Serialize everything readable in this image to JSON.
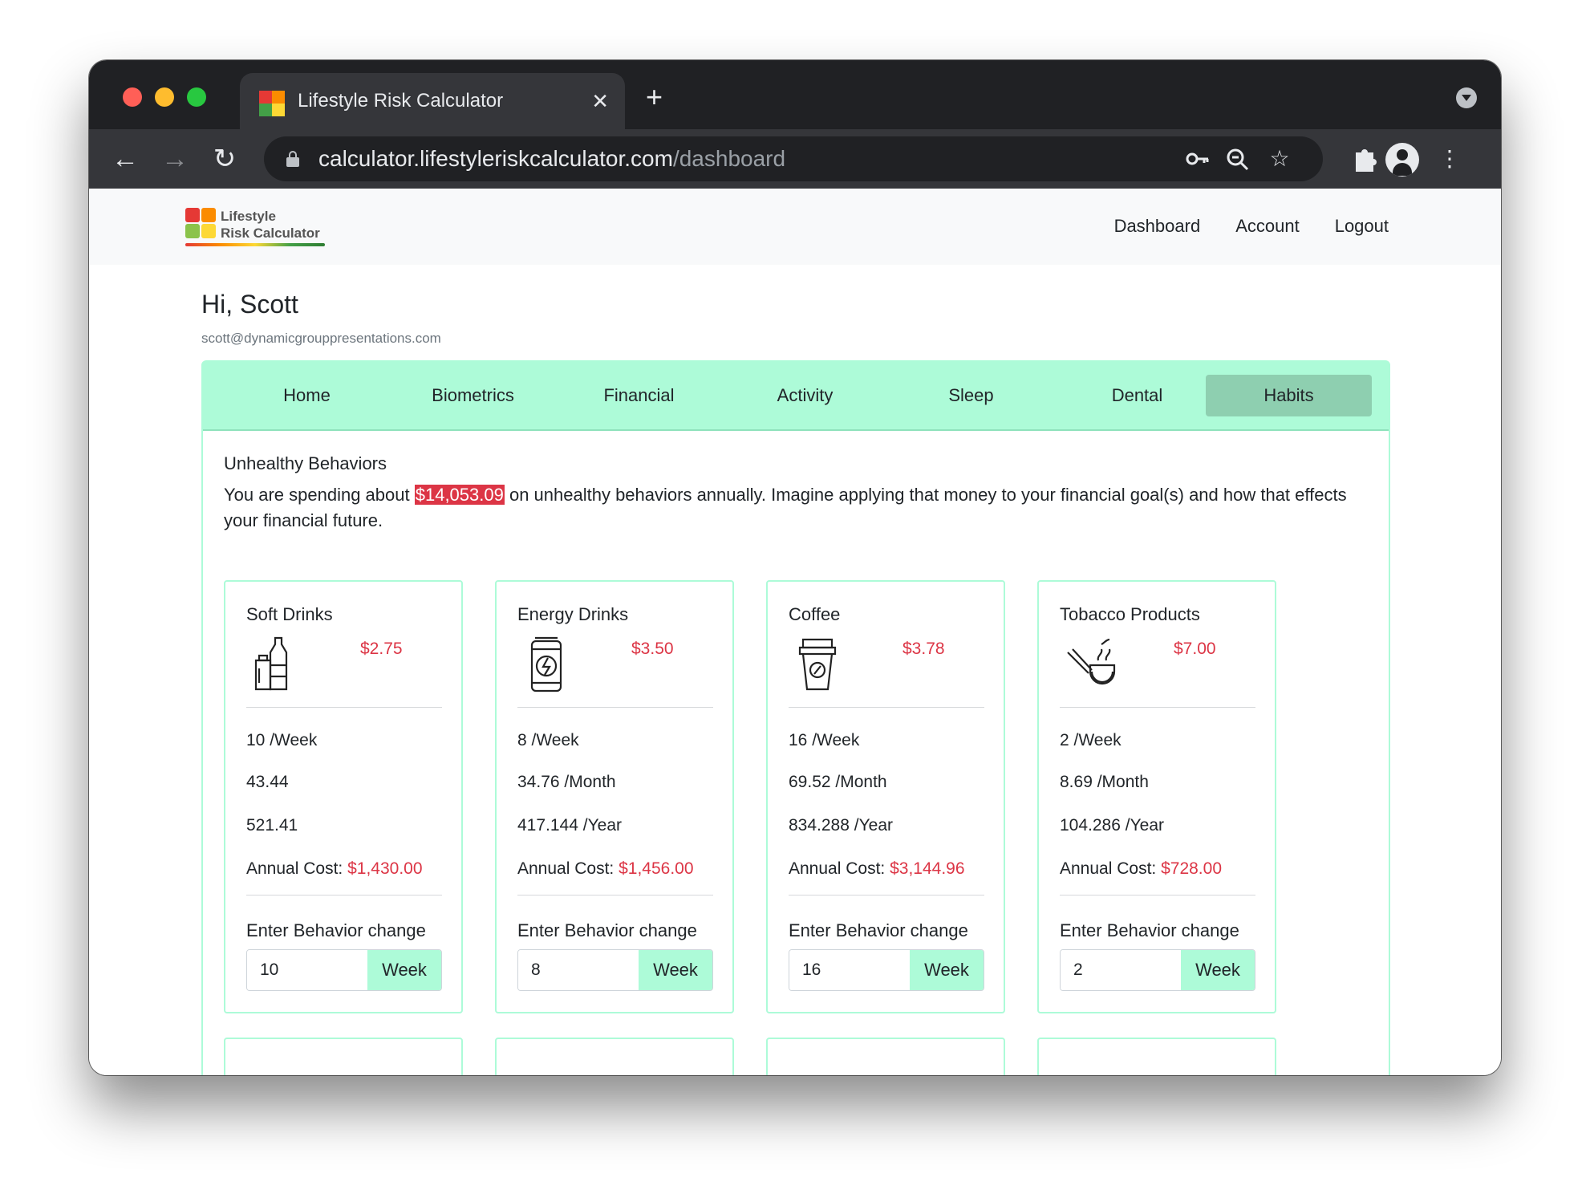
{
  "browser": {
    "tab_title": "Lifestyle Risk Calculator",
    "tab_close": "✕",
    "new_tab": "+",
    "url_host": "calculator.lifestyleriskcalculator.com",
    "url_path": "/dashboard"
  },
  "site": {
    "logo_line1": "Lifestyle",
    "logo_line2": "Risk Calculator",
    "nav": [
      "Dashboard",
      "Account",
      "Logout"
    ]
  },
  "user": {
    "greeting": "Hi, Scott",
    "email": "scott@dynamicgrouppresentations.com"
  },
  "tabs": [
    "Home",
    "Biometrics",
    "Financial",
    "Activity",
    "Sleep",
    "Dental",
    "Habits"
  ],
  "active_tab": "Habits",
  "habits_section": {
    "title": "Unhealthy Behaviors",
    "text_before": "You are spending about ",
    "amount": "$14,053.09",
    "text_after": " on unhealthy behaviors annually. Imagine applying that money to your financial goal(s) and how that effects your financial future."
  },
  "habits": [
    {
      "name": "Soft Drinks",
      "price": "$2.75",
      "icon": "soda-bottle-icon",
      "weekly": "10 /Week",
      "monthly": "43.44",
      "yearly": "521.41",
      "annual_label": "Annual Cost:",
      "annual_cost": "$1,430.00",
      "change_label": "Enter Behavior change",
      "change_value": "10",
      "unit": "Week"
    },
    {
      "name": "Energy Drinks",
      "price": "$3.50",
      "icon": "energy-can-icon",
      "weekly": "8 /Week",
      "monthly": "34.76 /Month",
      "yearly": "417.144 /Year",
      "annual_label": "Annual Cost:",
      "annual_cost": "$1,456.00",
      "change_label": "Enter Behavior change",
      "change_value": "8",
      "unit": "Week"
    },
    {
      "name": "Coffee",
      "price": "$3.78",
      "icon": "coffee-cup-icon",
      "weekly": "16 /Week",
      "monthly": "69.52 /Month",
      "yearly": "834.288 /Year",
      "annual_label": "Annual Cost:",
      "annual_cost": "$3,144.96",
      "change_label": "Enter Behavior change",
      "change_value": "16",
      "unit": "Week"
    },
    {
      "name": "Tobacco Products",
      "price": "$7.00",
      "icon": "tobacco-pipe-icon",
      "weekly": "2 /Week",
      "monthly": "8.69 /Month",
      "yearly": "104.286 /Year",
      "annual_label": "Annual Cost:",
      "annual_cost": "$728.00",
      "change_label": "Enter Behavior change",
      "change_value": "2",
      "unit": "Week"
    }
  ],
  "colors": {
    "accent": "#adfbd8",
    "active_tab": "#8ecfb0",
    "cost_red": "#dc3545"
  }
}
